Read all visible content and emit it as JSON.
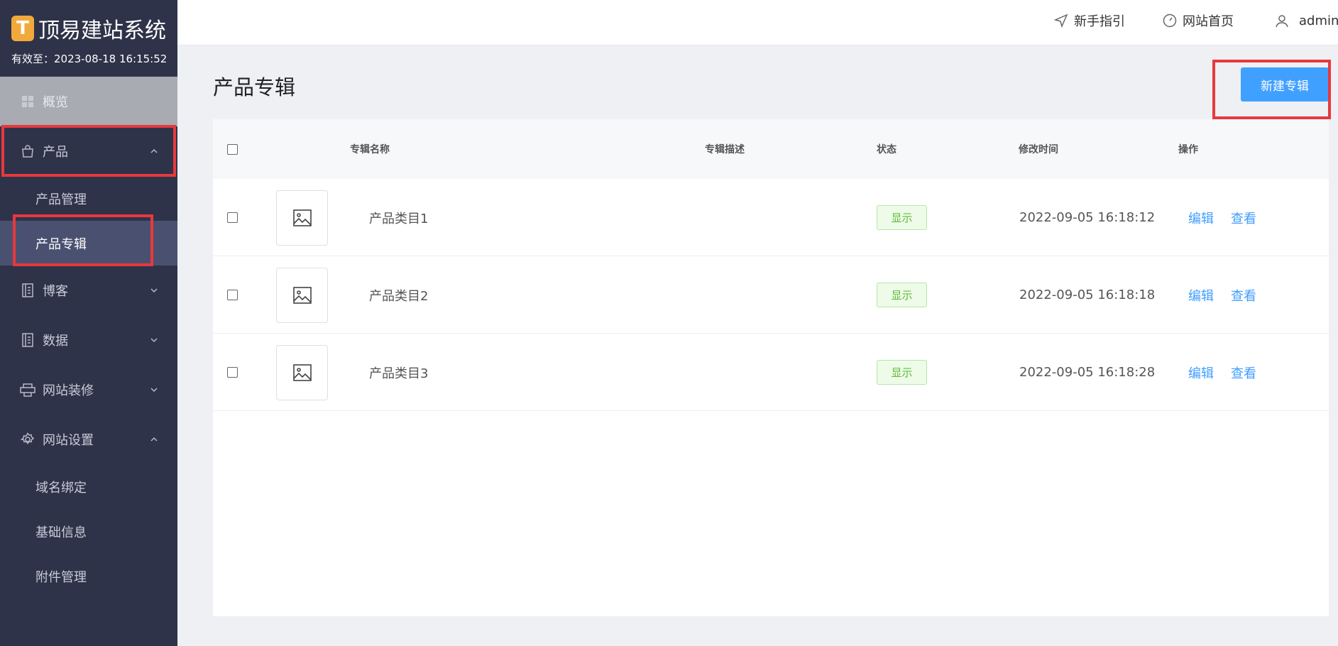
{
  "brand": {
    "name": "顶易建站系统",
    "logo_glyph": "T",
    "expire": "有效至：2023-08-18 16:15:52"
  },
  "sidebar": {
    "items": [
      {
        "label": "概览",
        "icon": "grid-icon"
      },
      {
        "label": "产品",
        "icon": "bag-icon",
        "expanded": true
      },
      {
        "label": "产品管理"
      },
      {
        "label": "产品专辑",
        "active": true
      },
      {
        "label": "博客",
        "icon": "document-icon"
      },
      {
        "label": "数据",
        "icon": "document-icon"
      },
      {
        "label": "网站装修",
        "icon": "printer-icon"
      },
      {
        "label": "网站设置",
        "icon": "gear-icon",
        "expanded": true
      },
      {
        "label": "域名绑定"
      },
      {
        "label": "基础信息"
      },
      {
        "label": "附件管理"
      }
    ]
  },
  "header": {
    "guide": "新手指引",
    "home": "网站首页",
    "user": "admin"
  },
  "page": {
    "title": "产品专辑",
    "new_button": "新建专辑"
  },
  "table": {
    "columns": [
      "专辑名称",
      "专辑描述",
      "状态",
      "修改时间",
      "操作"
    ],
    "rows": [
      {
        "name": "产品类目1",
        "status": "显示",
        "time": "2022-09-05 16:18:12",
        "edit": "编辑",
        "view": "查看"
      },
      {
        "name": "产品类目2",
        "status": "显示",
        "time": "2022-09-05 16:18:18",
        "edit": "编辑",
        "view": "查看"
      },
      {
        "name": "产品类目3",
        "status": "显示",
        "time": "2022-09-05 16:18:28",
        "edit": "编辑",
        "view": "查看"
      }
    ]
  },
  "colors": {
    "sidebar_bg": "#2e3349",
    "accent": "#40a0ff",
    "highlight": "#e8383d",
    "status_green": "#5fbd3c"
  }
}
